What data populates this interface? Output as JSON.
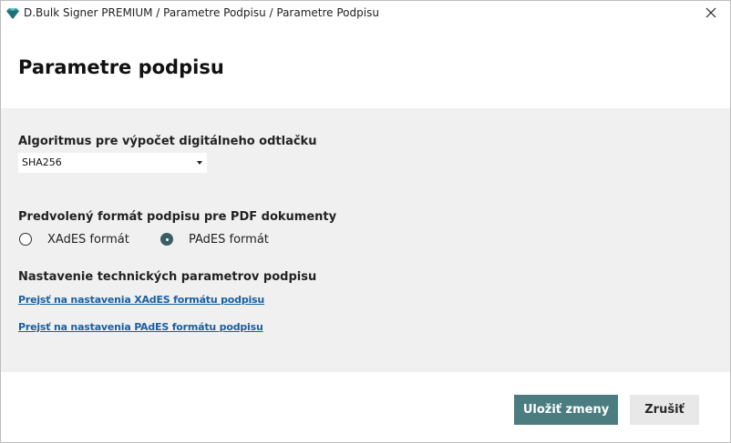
{
  "window": {
    "title": "D.Bulk Signer PREMIUM / Parametre Podpisu / Parametre Podpisu",
    "icon": "diamond-app-icon",
    "close_icon": "close-icon"
  },
  "header": {
    "title": "Parametre podpisu"
  },
  "digest": {
    "label": "Algoritmus pre výpočet digitálneho odtlačku",
    "selected": "SHA256"
  },
  "pdf_format": {
    "label": "Predvolený formát podpisu pre PDF dokumenty",
    "options": [
      {
        "label": "XAdES formát",
        "checked": false
      },
      {
        "label": "PAdES formát",
        "checked": true
      }
    ]
  },
  "technical": {
    "label": "Nastavenie technických parametrov podpisu",
    "links": [
      "Prejsť na nastavenia XAdES formátu podpisu",
      "Prejsť na nastavenia PAdES formátu podpisu"
    ]
  },
  "footer": {
    "save_label": "Uložiť zmeny",
    "cancel_label": "Zrušiť"
  },
  "colors": {
    "primary_button": "#4b7c80",
    "link": "#1a5fa0",
    "content_background": "#f0f0f0"
  }
}
